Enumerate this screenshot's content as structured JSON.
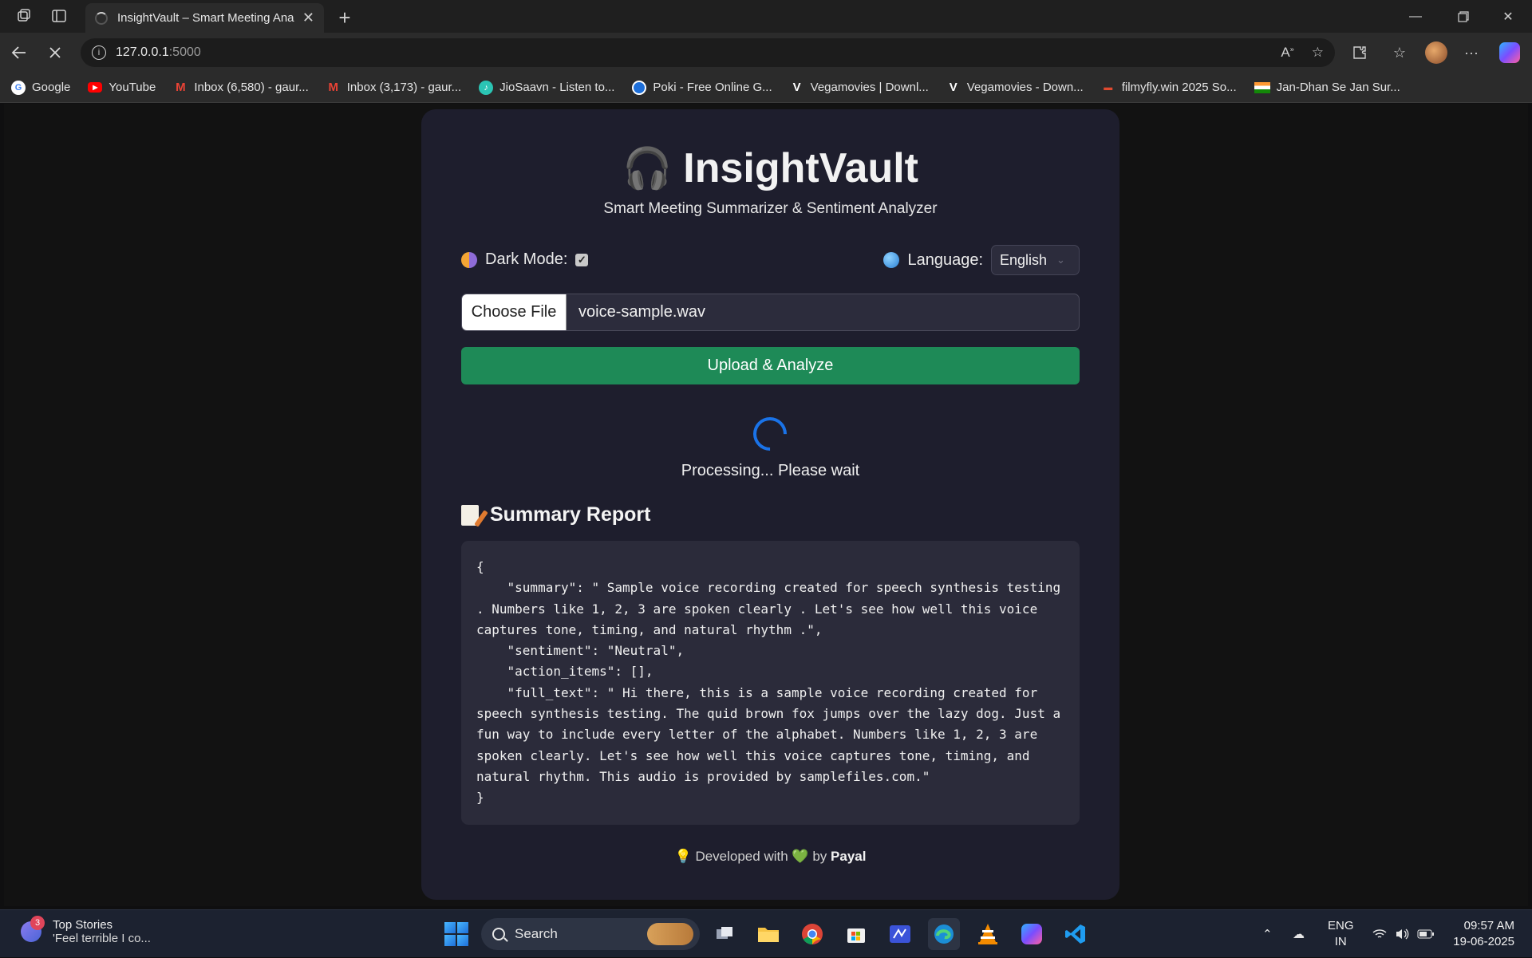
{
  "browser": {
    "tab_title": "InsightVault – Smart Meeting Ana",
    "url_host": "127.0.0.1",
    "url_port": ":5000",
    "bookmarks": [
      {
        "label": "Google",
        "icon": "google-icon",
        "color": "#4285f4"
      },
      {
        "label": "YouTube",
        "icon": "youtube-icon",
        "color": "#ff0000"
      },
      {
        "label": "Inbox (6,580) - gaur...",
        "icon": "gmail-icon",
        "color": "#ea4335"
      },
      {
        "label": "Inbox (3,173) - gaur...",
        "icon": "gmail-icon",
        "color": "#ea4335"
      },
      {
        "label": "JioSaavn - Listen to...",
        "icon": "jiosaavn-icon",
        "color": "#2bc5b4"
      },
      {
        "label": "Poki - Free Online G...",
        "icon": "poki-icon",
        "color": "#1e6fd9"
      },
      {
        "label": "Vegamovies | Downl...",
        "icon": "vegamovies-icon",
        "color": "#8b1538"
      },
      {
        "label": "Vegamovies - Down...",
        "icon": "vegamovies-icon",
        "color": "#8b1538"
      },
      {
        "label": "filmyfly.win 2025 So...",
        "icon": "filmyfly-icon",
        "color": "#e04a2f"
      },
      {
        "label": "Jan-Dhan Se Jan Sur...",
        "icon": "india-flag-icon",
        "color": "#ff9933"
      }
    ]
  },
  "app": {
    "title": "InsightVault",
    "subtitle": "Smart Meeting Summarizer & Sentiment Analyzer",
    "dark_mode_label": "Dark Mode:",
    "dark_mode_checked": true,
    "language_label": "Language:",
    "language_value": "English",
    "choose_file_label": "Choose File",
    "file_name": "voice-sample.wav",
    "upload_label": "Upload & Analyze",
    "processing_text": "Processing... Please wait",
    "report_title": "Summary Report",
    "report_json": "{\n    \"summary\": \" Sample voice recording created for speech synthesis testing . Numbers like 1, 2, 3 are spoken clearly . Let's see how well this voice captures tone, timing, and natural rhythm .\",\n    \"sentiment\": \"Neutral\",\n    \"action_items\": [],\n    \"full_text\": \" Hi there, this is a sample voice recording created for speech synthesis testing. The quid brown fox jumps over the lazy dog. Just a fun way to include every letter of the alphabet. Numbers like 1, 2, 3 are spoken clearly. Let's see how well this voice captures tone, timing, and natural rhythm. This audio is provided by samplefiles.com.\"\n}",
    "footer_prefix": "Developed with",
    "footer_by": "by",
    "footer_author": "Payal",
    "accent_color": "#1e8a57"
  },
  "taskbar": {
    "news_badge": "3",
    "news_title": "Top Stories",
    "news_sub": "'Feel terrible I co...",
    "search_label": "Search",
    "lang_top": "ENG",
    "lang_bottom": "IN",
    "time": "09:57 AM",
    "date": "19-06-2025"
  }
}
